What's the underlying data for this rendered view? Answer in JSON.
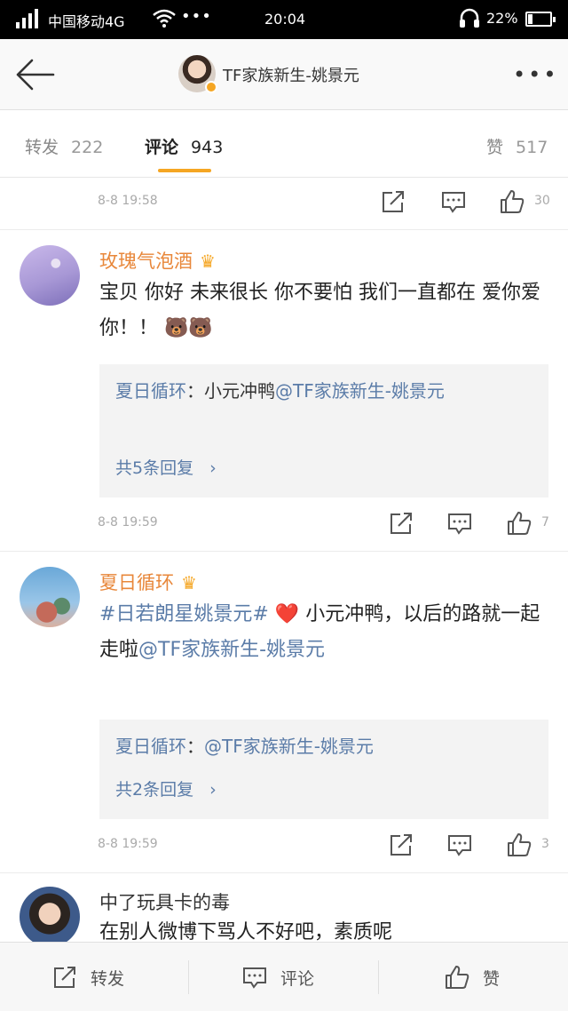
{
  "status_bar": {
    "carrier": "中国移动4G",
    "more_dots": "•••",
    "time": "20:04",
    "battery_percent": "22%",
    "battery_level": 0.22
  },
  "header": {
    "back_icon": "arrow-left-icon",
    "title": "TF家族新生-姚景元",
    "more": "•••"
  },
  "tabs": [
    {
      "label": "转发",
      "count": "222",
      "active": false
    },
    {
      "label": "评论",
      "count": "943",
      "active": true
    },
    {
      "label": "赞",
      "count": "517",
      "active": false
    }
  ],
  "comments": [
    {
      "timestamp": "8-8  19:58",
      "likes": "30"
    },
    {
      "user": "玫瑰气泡酒",
      "crown": "♛",
      "text": "宝贝 你好 未来很长 你不要怕 我们一直都在 爱你爱你！！",
      "emoji": "🐻🐻",
      "reply": {
        "user": "夏日循环",
        "text_prefix": "：小元冲鸭",
        "mention": "@TF家族新生-姚景元",
        "more_label": "共5条回复",
        "chevron": "›"
      },
      "timestamp": "8-8  19:59",
      "likes": "7"
    },
    {
      "user": "夏日循环",
      "crown": "♛",
      "hashtag": "#日若朗星姚景元#",
      "heart": "❤️",
      "text_after": "小元冲鸭，以后的路就一起走啦",
      "mention": "@TF家族新生-姚景元",
      "reply": {
        "user": "夏日循环",
        "text_prefix": "：",
        "mention": "@TF家族新生-姚景元",
        "more_label": "共2条回复",
        "chevron": "›"
      },
      "timestamp": "8-8  19:59",
      "likes": "3"
    },
    {
      "user": "中了玩具卡的毒",
      "text": "在别人微博下骂人不好吧，素质呢"
    }
  ],
  "bottom_bar": {
    "repost_label": "转发",
    "comment_label": "评论",
    "like_label": "赞"
  },
  "colors": {
    "accent": "#f5a623",
    "username": "#e8873a",
    "link": "#5b7ca8"
  }
}
